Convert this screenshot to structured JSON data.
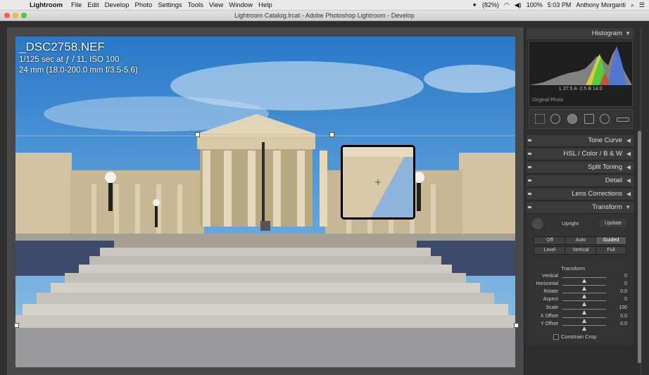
{
  "menubar": {
    "apple_icon": "apple-icon",
    "app_name": "Lightroom",
    "items": [
      "File",
      "Edit",
      "Develop",
      "Photo",
      "Settings",
      "Tools",
      "View",
      "Window",
      "Help"
    ],
    "battery_pct": "(82%)",
    "battery_main": "100%",
    "clock": "5:03 PM",
    "user": "Anthony Morganti"
  },
  "window": {
    "title": "Lightroom Catalog.lrcat - Adobe Photoshop Lightroom - Develop"
  },
  "photo_info": {
    "filename": "_DSC2758.NEF",
    "exposure": "1/125 sec at ƒ / 11, ISO 100",
    "lens": "24 mm (18.0-200.0 mm f/3.5-5.6)"
  },
  "histogram": {
    "title": "Histogram",
    "stats": "L  27.5  A  -2.5  B  14.0",
    "original_photo_label": "Original Photo"
  },
  "panels": {
    "tone_curve": "Tone Curve",
    "hsl": "HSL",
    "hsl_color": "Color",
    "hsl_bw": "B & W",
    "split_toning": "Split Toning",
    "detail": "Detail",
    "lens_corrections": "Lens Corrections",
    "transform": "Transform"
  },
  "upright": {
    "label": "Upright",
    "update": "Update",
    "buttons_row1": [
      "Off",
      "Auto",
      "Guided"
    ],
    "buttons_row2": [
      "Level",
      "Vertical",
      "Full"
    ],
    "selected": "Guided"
  },
  "transform": {
    "section_title": "Transform",
    "sliders": [
      {
        "name": "Vertical",
        "value": "0"
      },
      {
        "name": "Horizontal",
        "value": "0"
      },
      {
        "name": "Rotate",
        "value": "0.0"
      },
      {
        "name": "Aspect",
        "value": "0"
      },
      {
        "name": "Scale",
        "value": "100"
      },
      {
        "name": "X Offset",
        "value": "0.0"
      },
      {
        "name": "Y Offset",
        "value": "0.0"
      }
    ],
    "constrain_crop": "Constrain Crop"
  },
  "colors": {
    "panel_bg": "#2e2e2e",
    "header_bg": "#3b3b3b",
    "sky": "#3d8fd6"
  }
}
